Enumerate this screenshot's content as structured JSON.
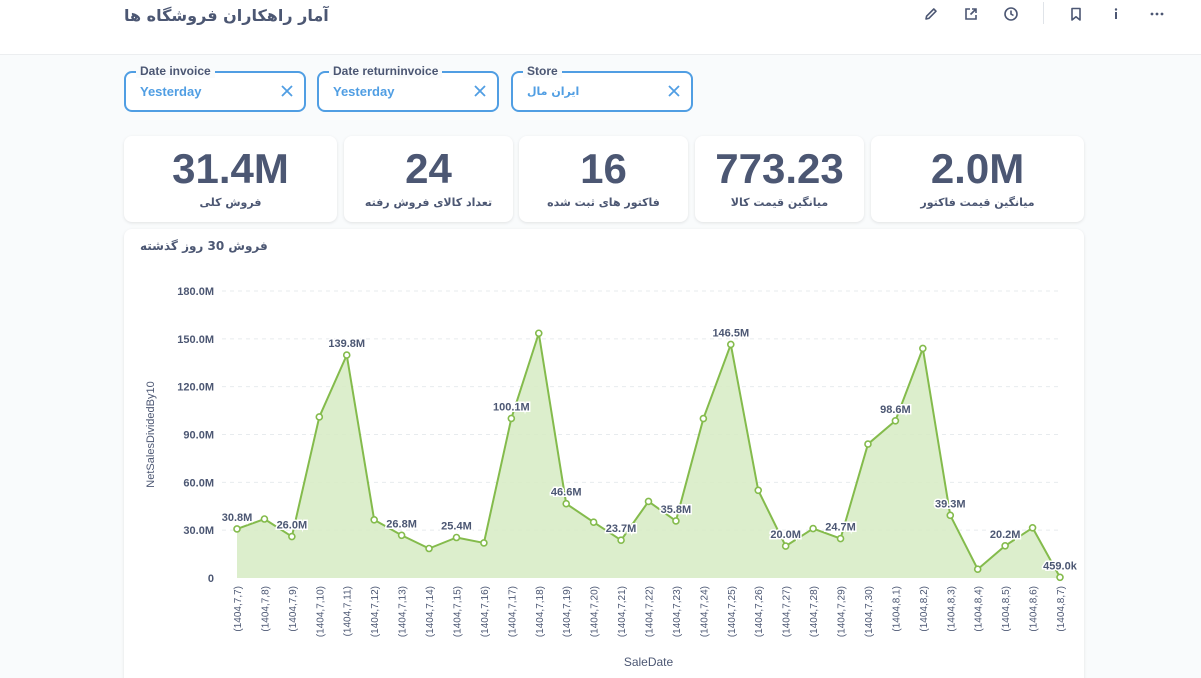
{
  "header": {
    "title": "آمار راهکاران فروشگاه ها",
    "actions": [
      {
        "name": "edit",
        "icon": "pencil-icon"
      },
      {
        "name": "share",
        "icon": "external-link-icon"
      },
      {
        "name": "history",
        "icon": "clock-icon"
      },
      {
        "name": "bookmark",
        "icon": "bookmark-icon"
      },
      {
        "name": "info",
        "icon": "info-icon"
      },
      {
        "name": "more",
        "icon": "ellipsis-icon"
      }
    ]
  },
  "filters": [
    {
      "label": "Date invoice",
      "value": "Yesterday"
    },
    {
      "label": "Date returninvoice",
      "value": "Yesterday"
    },
    {
      "label": "Store",
      "value": "ایران مال"
    }
  ],
  "kpis": [
    {
      "value": "31.4M",
      "label": "فروش کلی"
    },
    {
      "value": "24",
      "label": "تعداد کالای فروش رفته"
    },
    {
      "value": "16",
      "label": "فاکتور های ثبت شده"
    },
    {
      "value": "773.23",
      "label": "میانگین قیمت کالا"
    },
    {
      "value": "2.0M",
      "label": "میانگین قیمت فاکتور"
    }
  ],
  "chart_title": "فروش 30 روز گذشته",
  "colors": {
    "accent": "#509ee3",
    "series": "#84bb4c",
    "area": "#d6ebc3",
    "text": "#4c5773"
  },
  "chart_data": {
    "type": "area",
    "xlabel": "SaleDate",
    "ylabel": "NetSalesDividedBy10",
    "ylim": [
      0,
      180000000
    ],
    "yticks": [
      0,
      30000000,
      60000000,
      90000000,
      120000000,
      150000000,
      180000000
    ],
    "ytick_labels": [
      "0",
      "30.0M",
      "60.0M",
      "90.0M",
      "120.0M",
      "150.0M",
      "180.0M"
    ],
    "grid": true,
    "categories": [
      "(1404,7,7)",
      "(1404,7,8)",
      "(1404,7,9)",
      "(1404,7,10)",
      "(1404,7,11)",
      "(1404,7,12)",
      "(1404,7,13)",
      "(1404,7,14)",
      "(1404,7,15)",
      "(1404,7,16)",
      "(1404,7,17)",
      "(1404,7,18)",
      "(1404,7,19)",
      "(1404,7,20)",
      "(1404,7,21)",
      "(1404,7,22)",
      "(1404,7,23)",
      "(1404,7,24)",
      "(1404,7,25)",
      "(1404,7,26)",
      "(1404,7,27)",
      "(1404,7,28)",
      "(1404,7,29)",
      "(1404,7,30)",
      "(1404,8,1)",
      "(1404,8,2)",
      "(1404,8,3)",
      "(1404,8,4)",
      "(1404,8,5)",
      "(1404,8,6)",
      "(1404,8,7)"
    ],
    "values": [
      30800000,
      37000000,
      26000000,
      101000000,
      139800000,
      36500000,
      26800000,
      18500000,
      25400000,
      22000000,
      100100000,
      153500000,
      46600000,
      35000000,
      23700000,
      48000000,
      35800000,
      100000000,
      146500000,
      55000000,
      20000000,
      31000000,
      24700000,
      84000000,
      98600000,
      144000000,
      39300000,
      5500000,
      20200000,
      31500000,
      459000
    ],
    "data_labels": [
      "30.8M",
      "",
      "26.0M",
      "",
      "139.8M",
      "",
      "26.8M",
      "",
      "25.4M",
      "",
      "100.1M",
      "",
      "46.6M",
      "",
      "23.7M",
      "",
      "35.8M",
      "",
      "146.5M",
      "",
      "20.0M",
      "",
      "24.7M",
      "",
      "98.6M",
      "",
      "39.3M",
      "",
      "20.2M",
      "",
      "459.0k"
    ]
  }
}
